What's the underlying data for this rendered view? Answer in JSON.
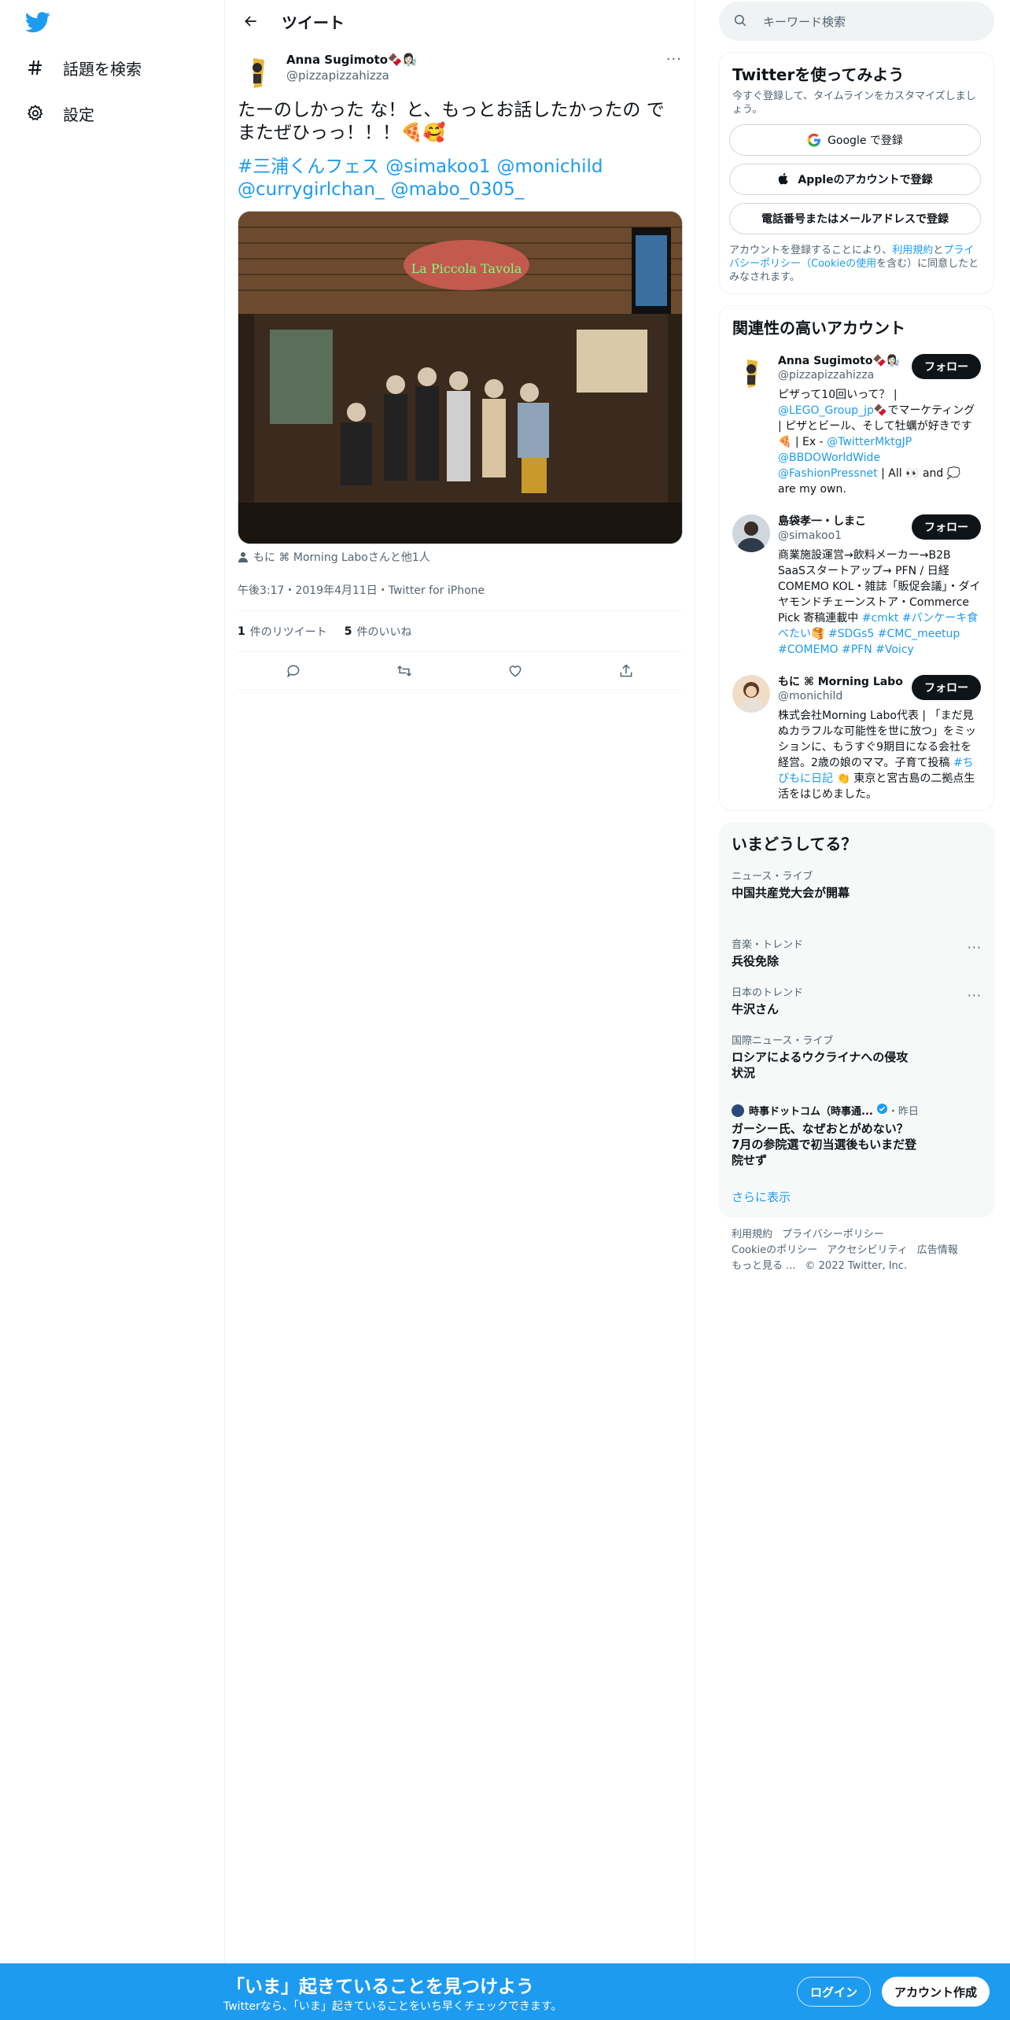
{
  "nav": {
    "explore_label": "話題を検索",
    "settings_label": "設定"
  },
  "header": {
    "title": "ツイート"
  },
  "tweet": {
    "author_name": "Anna Sugimoto🍫👩🏻‍🔬",
    "author_handle": "@pizzapizzahizza",
    "text": "たーのしかった な！と、もっとお話したかったの で\nまたぜひっっ！！！🍕🥰",
    "tags": [
      "#三浦くんフェス",
      "@simakoo1",
      "@monichild",
      "@currygirlchan_",
      "@mabo_0305_"
    ],
    "tagged_people": "もに ⌘ Morning Laboさんと他1人",
    "timestamp": "午後3:17・2019年4月11日・Twitter for iPhone",
    "retweets_count": "1",
    "retweets_label": "件のリツイート",
    "likes_count": "5",
    "likes_label": "件のいいね"
  },
  "search": {
    "placeholder": "キーワード検索"
  },
  "signup": {
    "title": "Twitterを使ってみよう",
    "subtitle": "今すぐ登録して、タイムラインをカスタマイズしましょう。",
    "google": "Google で登録",
    "apple": "Appleのアカウントで登録",
    "phone": "電話番号またはメールアドレスで登録",
    "legal_1": "アカウントを登録することにより、",
    "legal_terms": "利用規約",
    "legal_and": "と",
    "legal_privacy": "プライバシーポリシー（Cookieの使用",
    "legal_2": "を含む）に同意したとみなされます。"
  },
  "related": {
    "title": "関連性の高いアカウント",
    "follow_label": "フォロー",
    "accounts": [
      {
        "name": "Anna Sugimoto🍫👩🏻‍🔬",
        "handle": "@pizzapizzahizza",
        "bio_a": "ピザって10回いって？ | ",
        "bio_link1": "@LEGO_Group_jp",
        "bio_b": "🍫でマーケティング | ピザとビール、そして牡蠣が好きです🍕 | Ex - ",
        "bio_link2": "@TwitterMktgJP @BBDOWorldWide @FashionPressnet",
        "bio_c": " | All 👀 and 💭 are my own."
      },
      {
        "name": "島袋孝一・しまこ",
        "handle": "@simakoo1",
        "bio_a": "商業施設運営→飲料メーカー→B2B SaaSスタートアップ→ PFN / 日経COMEMO KOL・雑誌「販促会議」・ダイヤモンドチェーンストア・Commerce Pick 寄稿連載中 ",
        "bio_link1": "#cmkt #パンケーキ食べたい🥞 #SDGs5 #CMC_meetup #COMEMO #PFN #Voicy"
      },
      {
        "name": "もに ⌘ Morning Labo",
        "handle": "@monichild",
        "bio_a": "株式会社Morning Labo代表 | 「まだ見ぬカラフルな可能性を世に放つ」をミッションに、もうすぐ9期目になる会社を経営。2歳の娘のママ。子育て投稿 ",
        "bio_link1": "#ちびもに日記",
        "bio_b": " 👏 東京と宮古島の二拠点生活をはじめました。"
      }
    ]
  },
  "trends": {
    "title": "いまどうしてる？",
    "items": [
      {
        "context": "ニュース・ライブ",
        "title": "中国共産党大会が開幕"
      },
      {
        "context": "音楽・トレンド",
        "title": "兵役免除"
      },
      {
        "context": "日本のトレンド",
        "title": "牛沢さん"
      },
      {
        "context": "国際ニュース・ライブ",
        "title": "ロシアによるウクライナへの侵攻\n状況"
      }
    ],
    "news_source": "時事ドットコム（時事通...",
    "news_time": "・昨日",
    "news_title": "ガーシー氏、なぜおとがめない？\n7月の参院選で初当選後もいまだ登\n院せず",
    "show_more": "さらに表示"
  },
  "footer": {
    "terms": "利用規約",
    "privacy": "プライバシーポリシー",
    "cookie": "Cookieのポリシー",
    "accessibility": "アクセシビリティ",
    "ads": "広告情報",
    "more": "もっと見る ...",
    "copyright": "© 2022 Twitter, Inc."
  },
  "bottom_bar": {
    "title": "「いま」起きていることを見つけよう",
    "subtitle": "Twitterなら、「いま」起きていることをいち早くチェックできます。",
    "login": "ログイン",
    "signup": "アカウント作成"
  },
  "colors": {
    "accent": "#1d9bf0",
    "text": "#0f1419",
    "muted": "#536471"
  }
}
